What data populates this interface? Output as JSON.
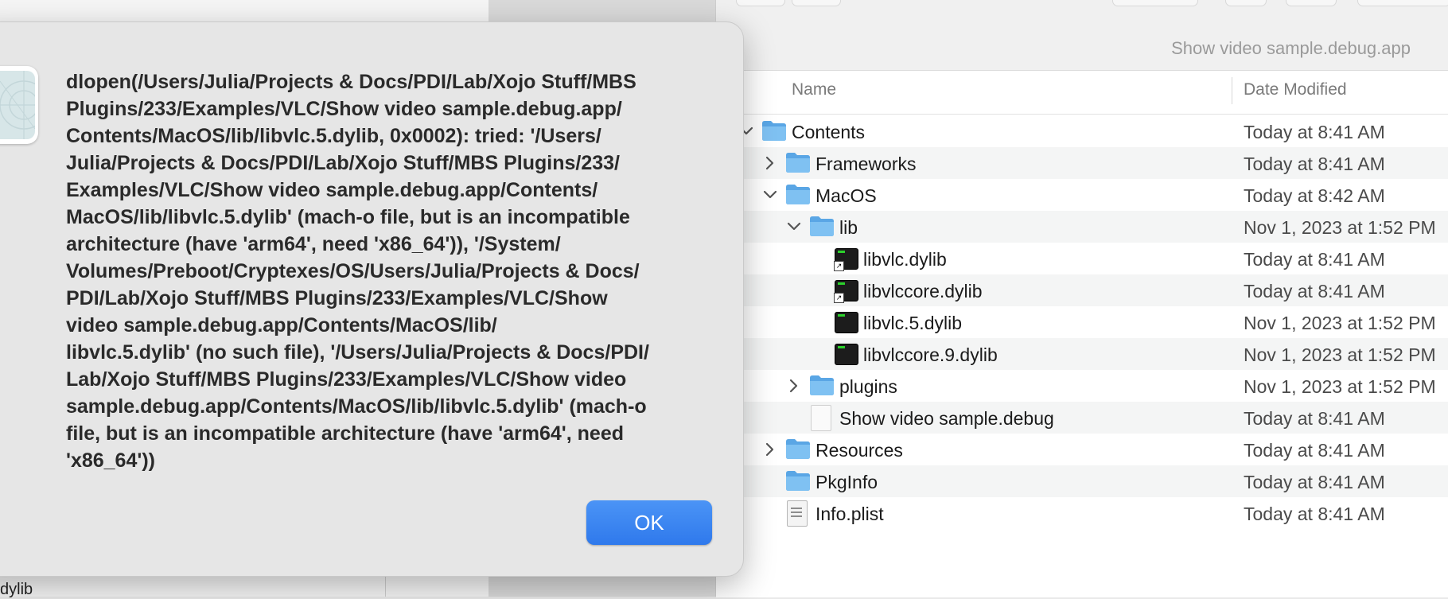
{
  "alert": {
    "message": "dlopen(/Users/Julia/Projects & Docs/PDI/Lab/Xojo Stuff/MBS\nPlugins/233/Examples/VLC/Show video sample.debug.app/\nContents/MacOS/lib/libvlc.5.dylib, 0x0002): tried: '/Users/\nJulia/Projects & Docs/PDI/Lab/Xojo Stuff/MBS Plugins/233/\nExamples/VLC/Show video sample.debug.app/Contents/\nMacOS/lib/libvlc.5.dylib' (mach-o file, but is an incompatible\narchitecture (have 'arm64', need 'x86_64')), '/System/\nVolumes/Preboot/Cryptexes/OS/Users/Julia/Projects & Docs/\nPDI/Lab/Xojo Stuff/MBS Plugins/233/Examples/VLC/Show\nvideo sample.debug.app/Contents/MacOS/lib/\nlibvlc.5.dylib' (no such file), '/Users/Julia/Projects & Docs/PDI/\nLab/Xojo Stuff/MBS Plugins/233/Examples/VLC/Show video\nsample.debug.app/Contents/MacOS/lib/libvlc.5.dylib' (mach-o\nfile, but is an incompatible architecture (have 'arm64', need\n'x86_64'))",
    "ok_label": "OK",
    "accent_color": "#3a84f0"
  },
  "finder": {
    "window_title": "Show video sample.debug.app",
    "columns": {
      "name": "Name",
      "date_modified": "Date Modified"
    },
    "rows": [
      {
        "name": "Contents",
        "date": "Today at 8:41 AM",
        "icon": "folder-icon",
        "disclosure": "expanded"
      },
      {
        "name": "Frameworks",
        "date": "Today at 8:41 AM",
        "icon": "folder-icon",
        "disclosure": "collapsed"
      },
      {
        "name": "MacOS",
        "date": "Today at 8:42 AM",
        "icon": "folder-icon",
        "disclosure": "expanded"
      },
      {
        "name": "lib",
        "date": "Nov 1, 2023 at 1:52 PM",
        "icon": "folder-icon",
        "disclosure": "expanded"
      },
      {
        "name": "libvlc.dylib",
        "date": "Today at 8:41 AM",
        "icon": "alias-exec-icon",
        "disclosure": "none"
      },
      {
        "name": "libvlccore.dylib",
        "date": "Today at 8:41 AM",
        "icon": "alias-exec-icon",
        "disclosure": "none"
      },
      {
        "name": "libvlc.5.dylib",
        "date": "Nov 1, 2023 at 1:52 PM",
        "icon": "exec-icon",
        "disclosure": "none"
      },
      {
        "name": "libvlccore.9.dylib",
        "date": "Nov 1, 2023 at 1:52 PM",
        "icon": "exec-icon",
        "disclosure": "none"
      },
      {
        "name": "plugins",
        "date": "Nov 1, 2023 at 1:52 PM",
        "icon": "folder-icon",
        "disclosure": "collapsed"
      },
      {
        "name": "Show video sample.debug",
        "date": "Today at 8:41 AM",
        "icon": "document-icon",
        "disclosure": "none"
      },
      {
        "name": "Resources",
        "date": "Today at 8:41 AM",
        "icon": "folder-icon",
        "disclosure": "collapsed"
      },
      {
        "name": "PkgInfo",
        "date": "Today at 8:41 AM",
        "icon": "folder-icon",
        "disclosure": "none"
      },
      {
        "name": "Info.plist",
        "date": "Today at 8:41 AM",
        "icon": "plist-icon",
        "disclosure": "none"
      }
    ]
  },
  "background_window": {
    "partial_text": "dylib"
  }
}
